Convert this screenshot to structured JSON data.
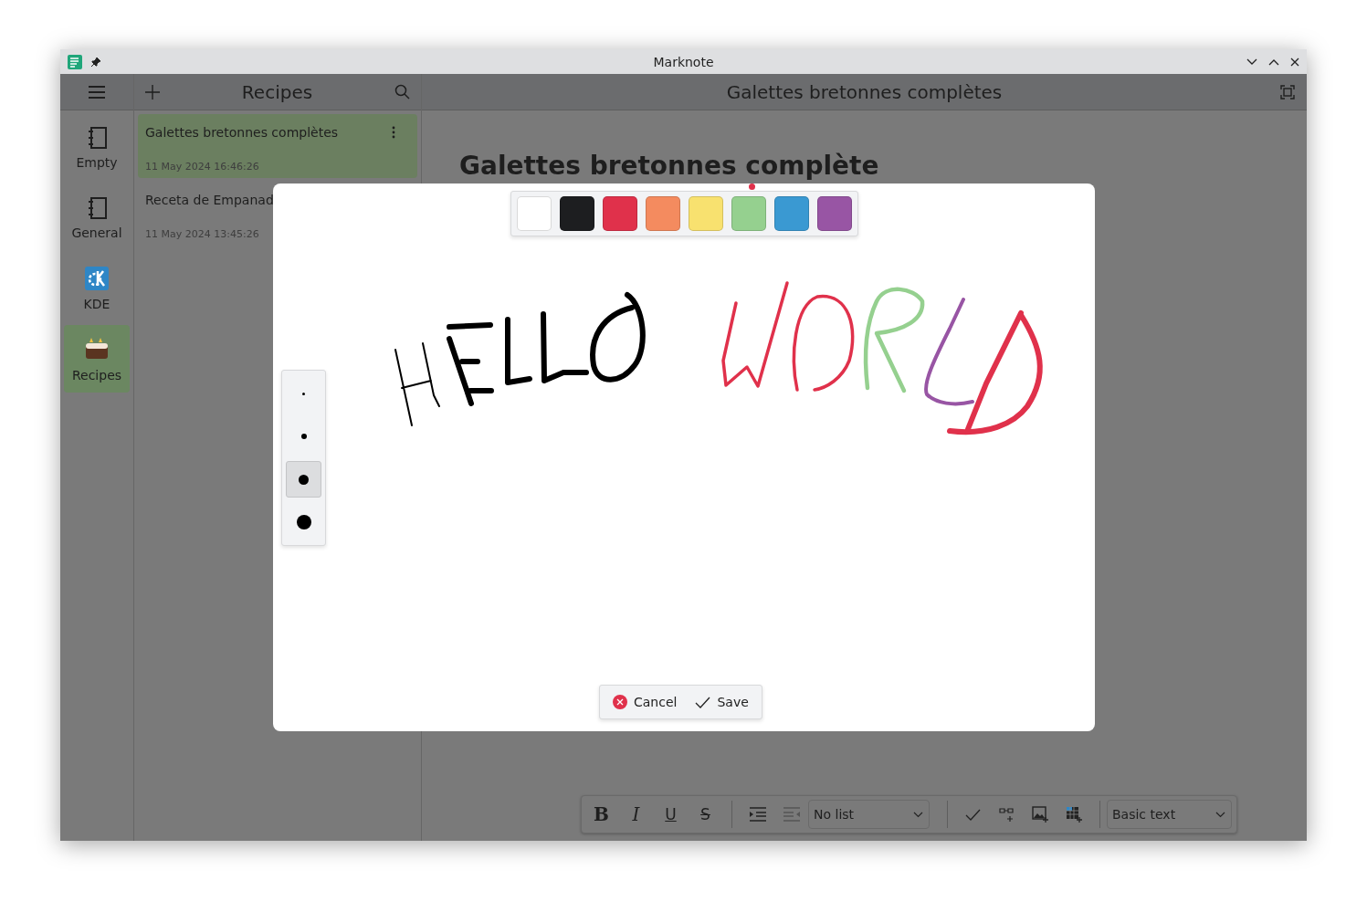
{
  "window": {
    "title": "Marknote"
  },
  "sidebar": {
    "items": [
      {
        "label": "Empty",
        "kind": "notebook",
        "selected": false
      },
      {
        "label": "General",
        "kind": "notebook",
        "selected": false
      },
      {
        "label": "KDE",
        "kind": "kde",
        "selected": false
      },
      {
        "label": "Recipes",
        "kind": "cake",
        "selected": true
      }
    ]
  },
  "note_list": {
    "title": "Recipes",
    "notes": [
      {
        "title": "Galettes bretonnes complètes",
        "date": "11 May 2024 16:46:26",
        "selected": true
      },
      {
        "title": "Receta de Empanad",
        "date": "11 May 2024 13:45:26",
        "selected": false
      }
    ]
  },
  "editor": {
    "header_title": "Galettes bretonnes complètes",
    "heading": "Galettes bretonnes complète",
    "format_buttons": [
      {
        "kind": "bold",
        "label": "B"
      },
      {
        "kind": "italic",
        "label": "I"
      },
      {
        "kind": "underline",
        "label": "U"
      },
      {
        "kind": "strike",
        "label": "S"
      }
    ],
    "list_dropdown": "No list",
    "style_dropdown": "Basic text"
  },
  "sketch_dialog": {
    "colors": [
      {
        "color": "#ffffff"
      },
      {
        "color": "#1d1e20"
      },
      {
        "color": "#e0314b"
      },
      {
        "color": "#f48b5f"
      },
      {
        "color": "#f8e16f"
      },
      {
        "color": "#95d08f"
      },
      {
        "color": "#3a99d2"
      },
      {
        "color": "#9855a4"
      }
    ],
    "pen_sizes": [
      {
        "selected": false
      },
      {
        "selected": false
      },
      {
        "selected": true
      },
      {
        "selected": false
      }
    ],
    "buttons": [
      {
        "kind": "cancel",
        "label": "Cancel"
      },
      {
        "kind": "save",
        "label": "Save"
      }
    ]
  }
}
